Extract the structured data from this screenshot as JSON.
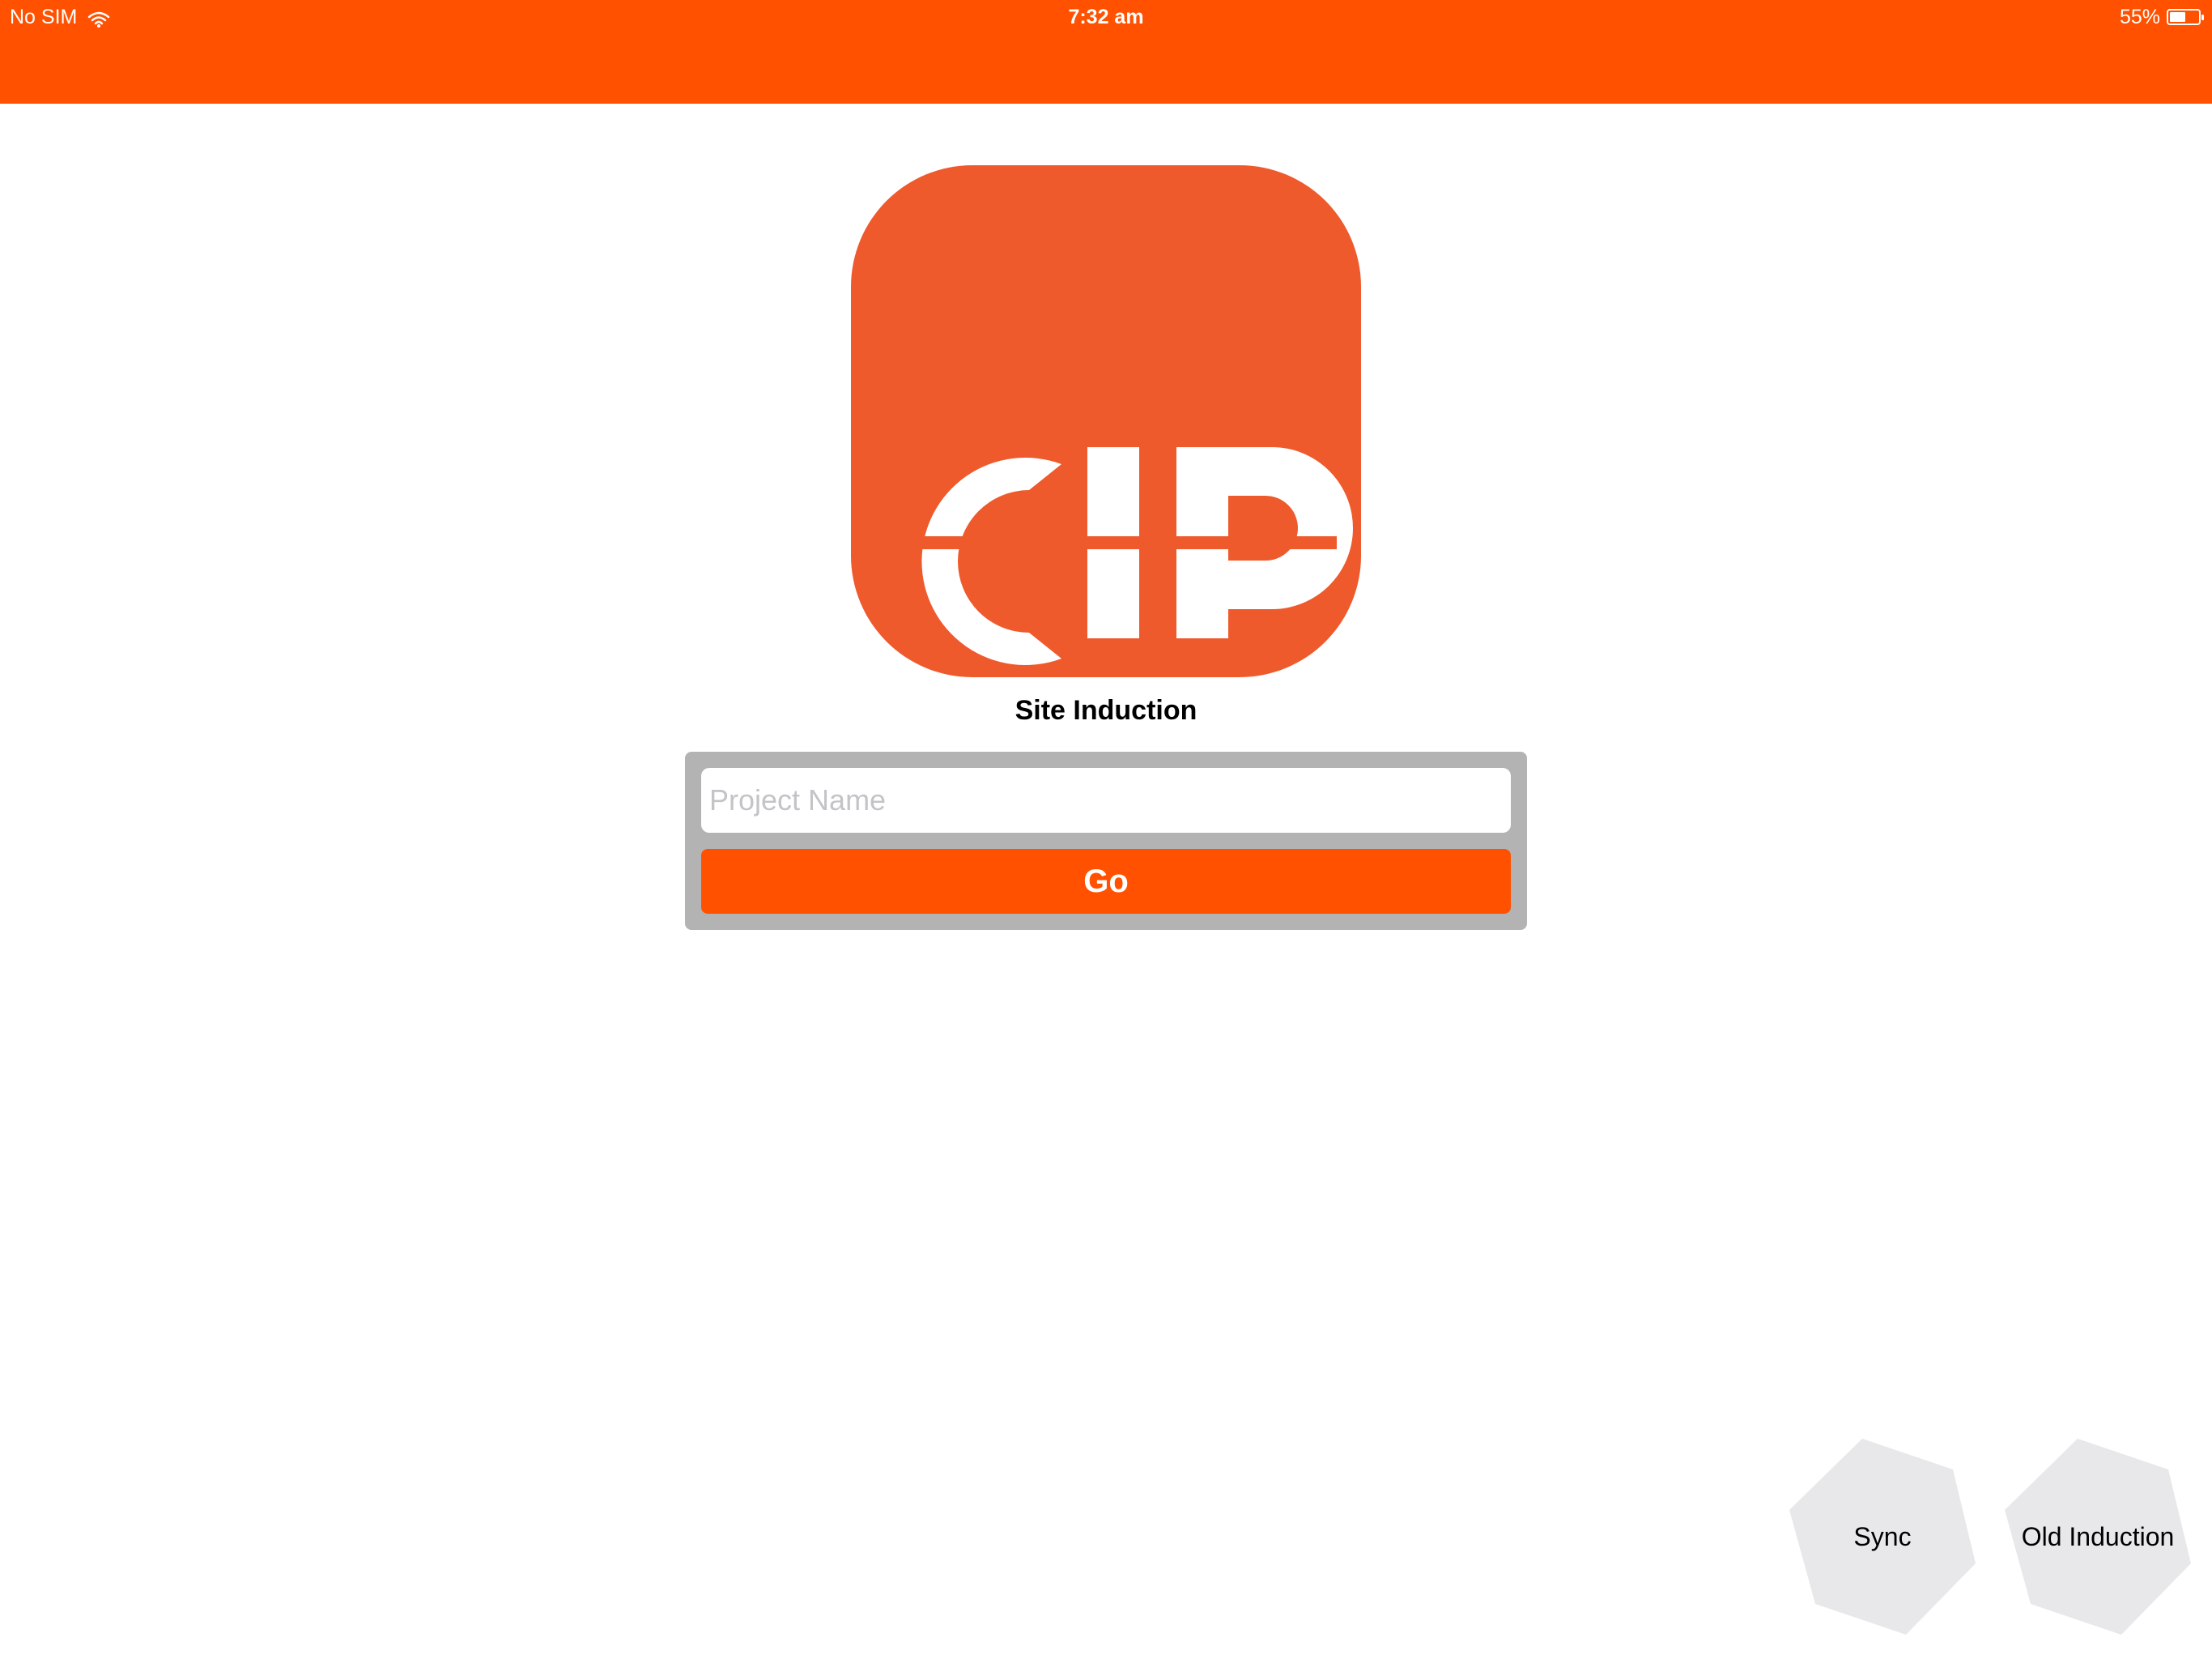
{
  "status_bar": {
    "carrier": "No SIM",
    "time": "7:32 am",
    "battery": "55%",
    "battery_level": 0.55
  },
  "logo": {
    "text": "CIP",
    "color": "#ef5a2d"
  },
  "main": {
    "title": "Site Induction",
    "project_input": {
      "value": "",
      "placeholder": "Project Name"
    },
    "go_label": "Go"
  },
  "corner_buttons": {
    "sync_label": "Sync",
    "old_induction_label": "Old Induction"
  },
  "colors": {
    "accent": "#ff5100",
    "panel": "#b3b3b3",
    "hex_button": "#e8e8ea"
  }
}
